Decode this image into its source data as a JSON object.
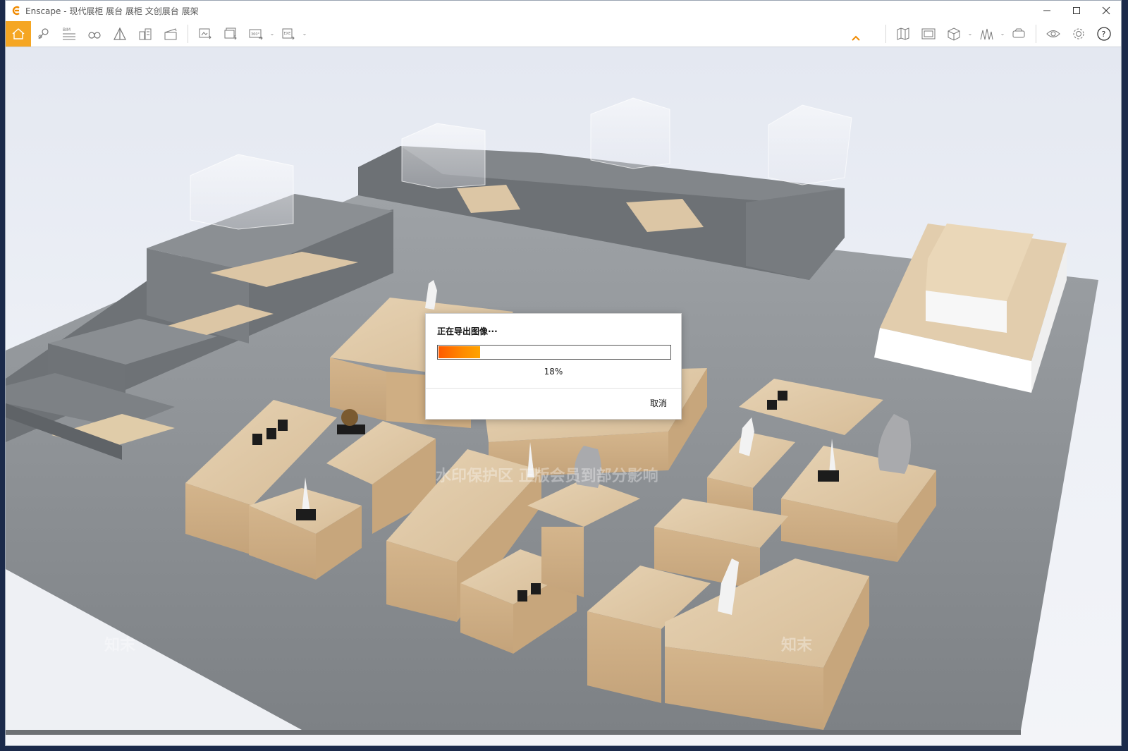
{
  "window": {
    "title": "Enscape - 现代展柜 展台 展柜 文创展台 展架",
    "controls": [
      "minimize",
      "maximize",
      "close"
    ]
  },
  "toolbar": {
    "left_icons": [
      {
        "name": "home-icon",
        "active": true
      },
      {
        "name": "location-icon"
      },
      {
        "name": "bim-icon",
        "label": "BIM"
      },
      {
        "name": "binoculars-icon"
      },
      {
        "name": "pyramid-icon"
      },
      {
        "name": "buildings-icon"
      },
      {
        "name": "clapperboard-icon"
      },
      {
        "name": "screenshot-icon"
      },
      {
        "name": "batch-render-icon"
      },
      {
        "name": "panorama-360-icon",
        "label": "360°"
      },
      {
        "name": "export-exe-icon",
        "label": "EXE"
      }
    ],
    "right_icons": [
      {
        "name": "map-icon"
      },
      {
        "name": "image-gallery-icon"
      },
      {
        "name": "cube-icon"
      },
      {
        "name": "chart-tree-icon"
      },
      {
        "name": "vr-headset-icon"
      },
      {
        "name": "eye-icon"
      },
      {
        "name": "gear-icon"
      },
      {
        "name": "help-icon"
      }
    ]
  },
  "export_dialog": {
    "title": "正在导出图像···",
    "progress": 0.18,
    "progress_text": "18%",
    "cancel_label": "取消"
  },
  "colors": {
    "accent": "#f5a623",
    "progress_start": "#ff5a00",
    "progress_end": "#ffa300",
    "floor": "#8e9296",
    "wood": "#dcc3a0",
    "concrete": "#6f7377"
  },
  "watermark_text": "水印保护区 正版会员到部分影响",
  "watermark_brand": "知末"
}
